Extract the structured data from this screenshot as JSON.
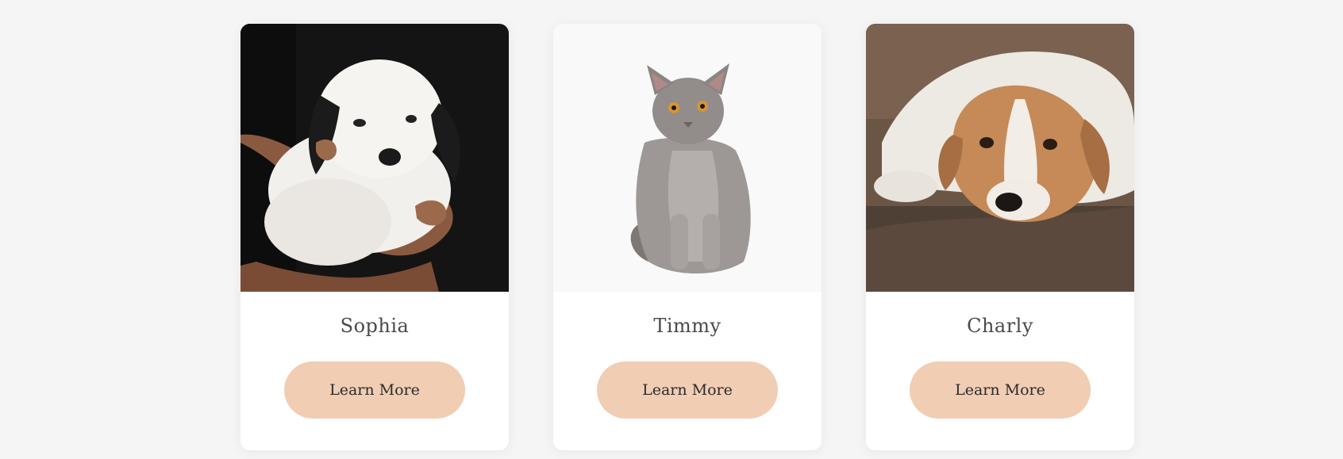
{
  "colors": {
    "page_background": "#f5f5f5",
    "card_background": "#ffffff",
    "button_background": "#f1cdb3",
    "name_text": "#4a4a4a",
    "button_text": "#2b2b2b"
  },
  "pets": [
    {
      "name": "Sophia",
      "photo": "white-black-puppy-held-in-hand",
      "button_label": "Learn More"
    },
    {
      "name": "Timmy",
      "photo": "gray-cat-sitting",
      "button_label": "Learn More"
    },
    {
      "name": "Charly",
      "photo": "brown-white-dog-lying-on-couch",
      "button_label": "Learn More"
    }
  ]
}
